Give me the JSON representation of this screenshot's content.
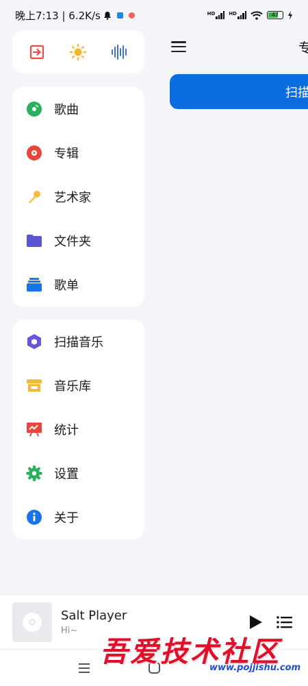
{
  "status_bar": {
    "time_speed": "晚上7:13 | 6.2K/s",
    "signal_1_label": "HD",
    "signal_2_label": "HD",
    "battery_level": "47",
    "colors": {
      "notif_blue": "#1e88e5",
      "notif_red": "#f0625a",
      "battery": "#3bb14a"
    }
  },
  "quick_actions": {
    "icons": [
      "exit-icon",
      "brightness-icon",
      "waveform-icon"
    ],
    "colors": [
      "#ee4b43",
      "#f7b52b",
      "#3c6ee8"
    ]
  },
  "library_nav": [
    {
      "label": "歌曲",
      "icon": "song-disc-icon",
      "color": "#29b05a"
    },
    {
      "label": "专辑",
      "icon": "album-disc-icon",
      "color": "#e8453c"
    },
    {
      "label": "艺术家",
      "icon": "microphone-icon",
      "color": "#f4bd40"
    },
    {
      "label": "文件夹",
      "icon": "folder-icon",
      "color": "#5b55d6"
    },
    {
      "label": "歌单",
      "icon": "playlist-stack-icon",
      "color": "#1a73e8"
    }
  ],
  "tools_nav": [
    {
      "label": "扫描音乐",
      "icon": "scan-cube-icon",
      "color": "#6a55d8"
    },
    {
      "label": "音乐库",
      "icon": "store-icon",
      "color": "#f4b93a"
    },
    {
      "label": "统计",
      "icon": "stats-board-icon",
      "color": "#e8453c"
    },
    {
      "label": "设置",
      "icon": "gear-icon",
      "color": "#29b05a"
    },
    {
      "label": "关于",
      "icon": "info-icon",
      "color": "#1a73e8"
    }
  ],
  "main": {
    "title_partial": "专",
    "scan_button_partial": "扫描"
  },
  "player": {
    "title": "Salt Player",
    "subtitle": "Hi~"
  },
  "watermark": {
    "text": "吾爱技术社区",
    "url": "www.pojjishu.com"
  }
}
